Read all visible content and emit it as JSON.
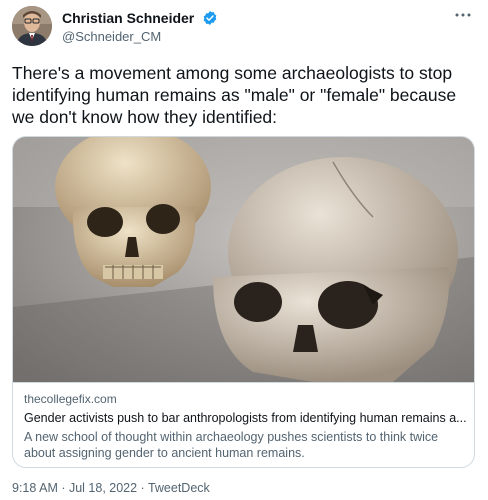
{
  "user": {
    "display_name": "Christian Schneider",
    "handle": "@Schneider_CM"
  },
  "icons": {
    "verified": "verified-badge-icon",
    "more": "more-options-icon"
  },
  "colors": {
    "verified": "#1d9bf0",
    "secondary_text": "#536471"
  },
  "tweet": {
    "text": "There's a movement among some archaeologists to stop identifying human remains as \"male\" or \"female\" because we don't know how they identified:"
  },
  "card": {
    "domain": "thecollegefix.com",
    "title": "Gender activists push to bar anthropologists from identifying human remains a...",
    "description": "A new school of thought within archaeology pushes scientists to think twice about assigning gender to ancient human remains."
  },
  "meta": {
    "timestamp": "9:18 AM · Jul 18, 2022 · TweetDeck"
  }
}
